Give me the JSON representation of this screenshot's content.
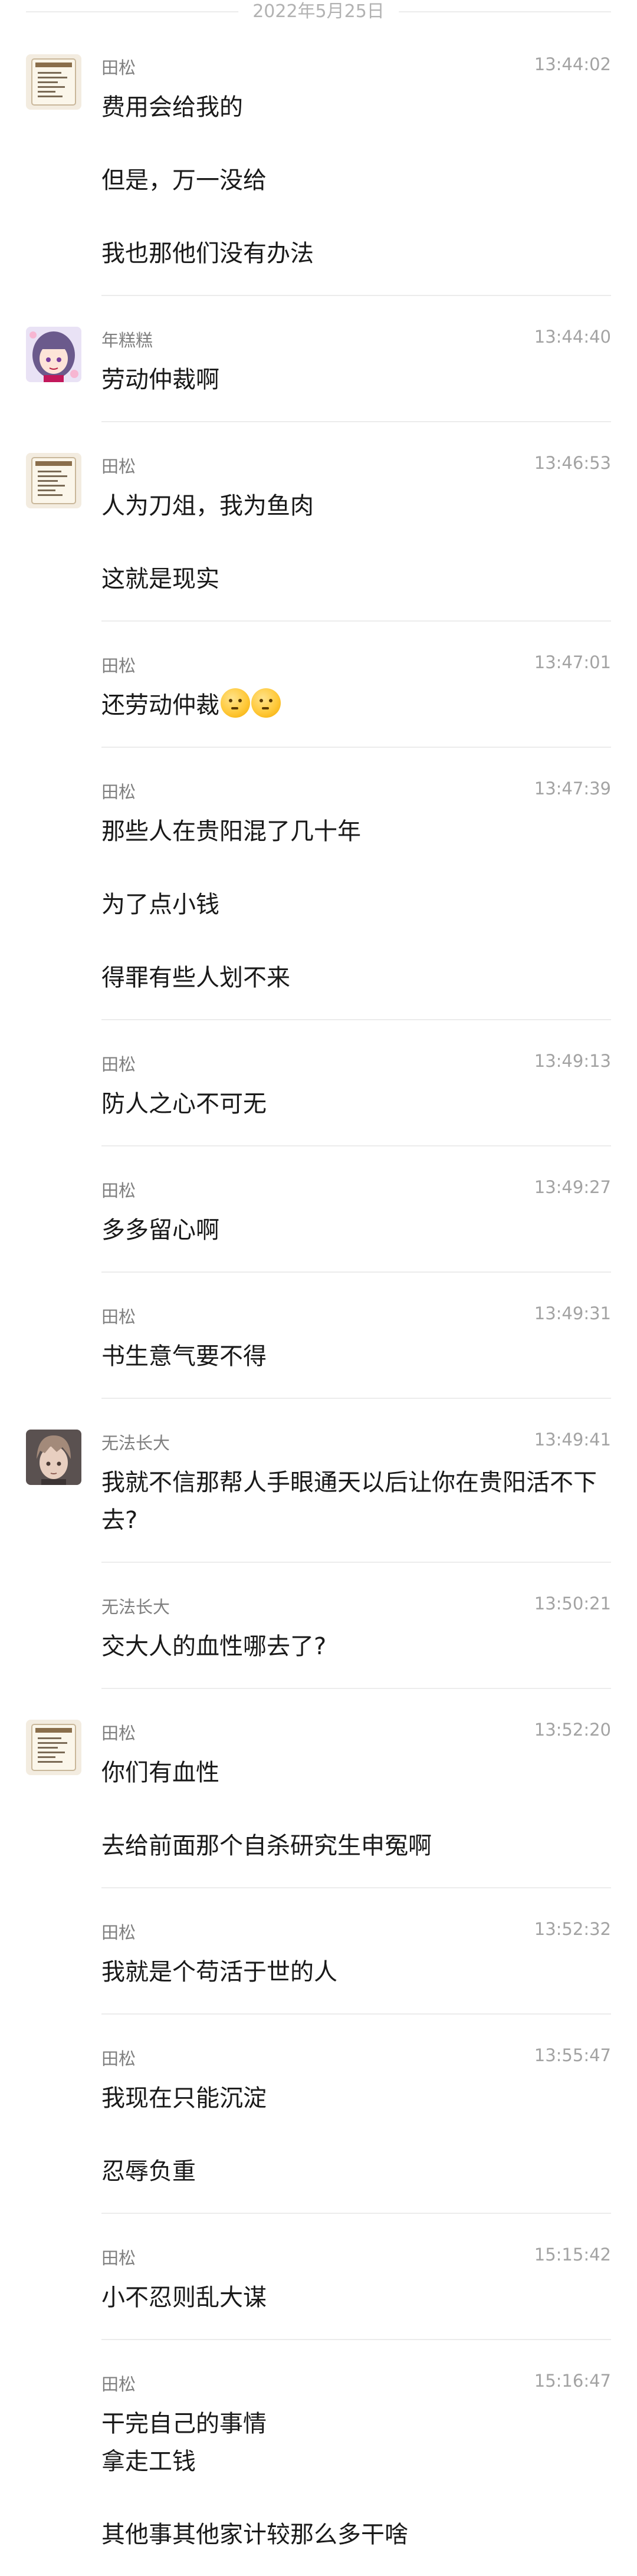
{
  "date_separator": "2022年5月25日",
  "messages": [
    {
      "sender": "田松",
      "time": "13:44:02",
      "avatar": "scroll-avatar",
      "paras": [
        "费用会给我的",
        "但是，万一没给",
        "我也那他们没有办法"
      ]
    },
    {
      "sender": "年糕糕",
      "time": "13:44:40",
      "avatar": "anime-girl-avatar",
      "paras": [
        "劳动仲裁啊"
      ]
    },
    {
      "sender": "田松",
      "time": "13:46:53",
      "avatar": "scroll-avatar",
      "paras": [
        "人为刀俎，我为鱼肉",
        "这就是现实"
      ]
    },
    {
      "sender": "田松",
      "time": "13:47:01",
      "avatar": "",
      "paras": [
        "还劳动仲裁"
      ],
      "emojis": [
        "shush-emoji",
        "shush-emoji"
      ]
    },
    {
      "sender": "田松",
      "time": "13:47:39",
      "avatar": "",
      "paras": [
        "那些人在贵阳混了几十年",
        "为了点小钱",
        "得罪有些人划不来"
      ]
    },
    {
      "sender": "田松",
      "time": "13:49:13",
      "avatar": "",
      "paras": [
        "防人之心不可无"
      ]
    },
    {
      "sender": "田松",
      "time": "13:49:27",
      "avatar": "",
      "paras": [
        "多多留心啊"
      ]
    },
    {
      "sender": "田松",
      "time": "13:49:31",
      "avatar": "",
      "paras": [
        "书生意气要不得"
      ]
    },
    {
      "sender": "无法长大",
      "time": "13:49:41",
      "avatar": "anime-boy-avatar",
      "paras": [
        "我就不信那帮人手眼通天以后让你在贵阳活不下去?"
      ]
    },
    {
      "sender": "无法长大",
      "time": "13:50:21",
      "avatar": "",
      "paras": [
        "交大人的血性哪去了?"
      ]
    },
    {
      "sender": "田松",
      "time": "13:52:20",
      "avatar": "scroll-avatar",
      "paras": [
        "你们有血性",
        "去给前面那个自杀研究生申冤啊"
      ]
    },
    {
      "sender": "田松",
      "time": "13:52:32",
      "avatar": "",
      "paras": [
        "我就是个苟活于世的人"
      ]
    },
    {
      "sender": "田松",
      "time": "13:55:47",
      "avatar": "",
      "paras": [
        "我现在只能沉淀",
        "忍辱负重"
      ]
    },
    {
      "sender": "田松",
      "time": "15:15:42",
      "avatar": "",
      "paras": [
        "小不忍则乱大谋"
      ]
    },
    {
      "sender": "田松",
      "time": "15:16:47",
      "avatar": "",
      "paras": [
        "干完自己的事情\n拿走工钱",
        "其他事其他家计较那么多干啥"
      ]
    }
  ]
}
